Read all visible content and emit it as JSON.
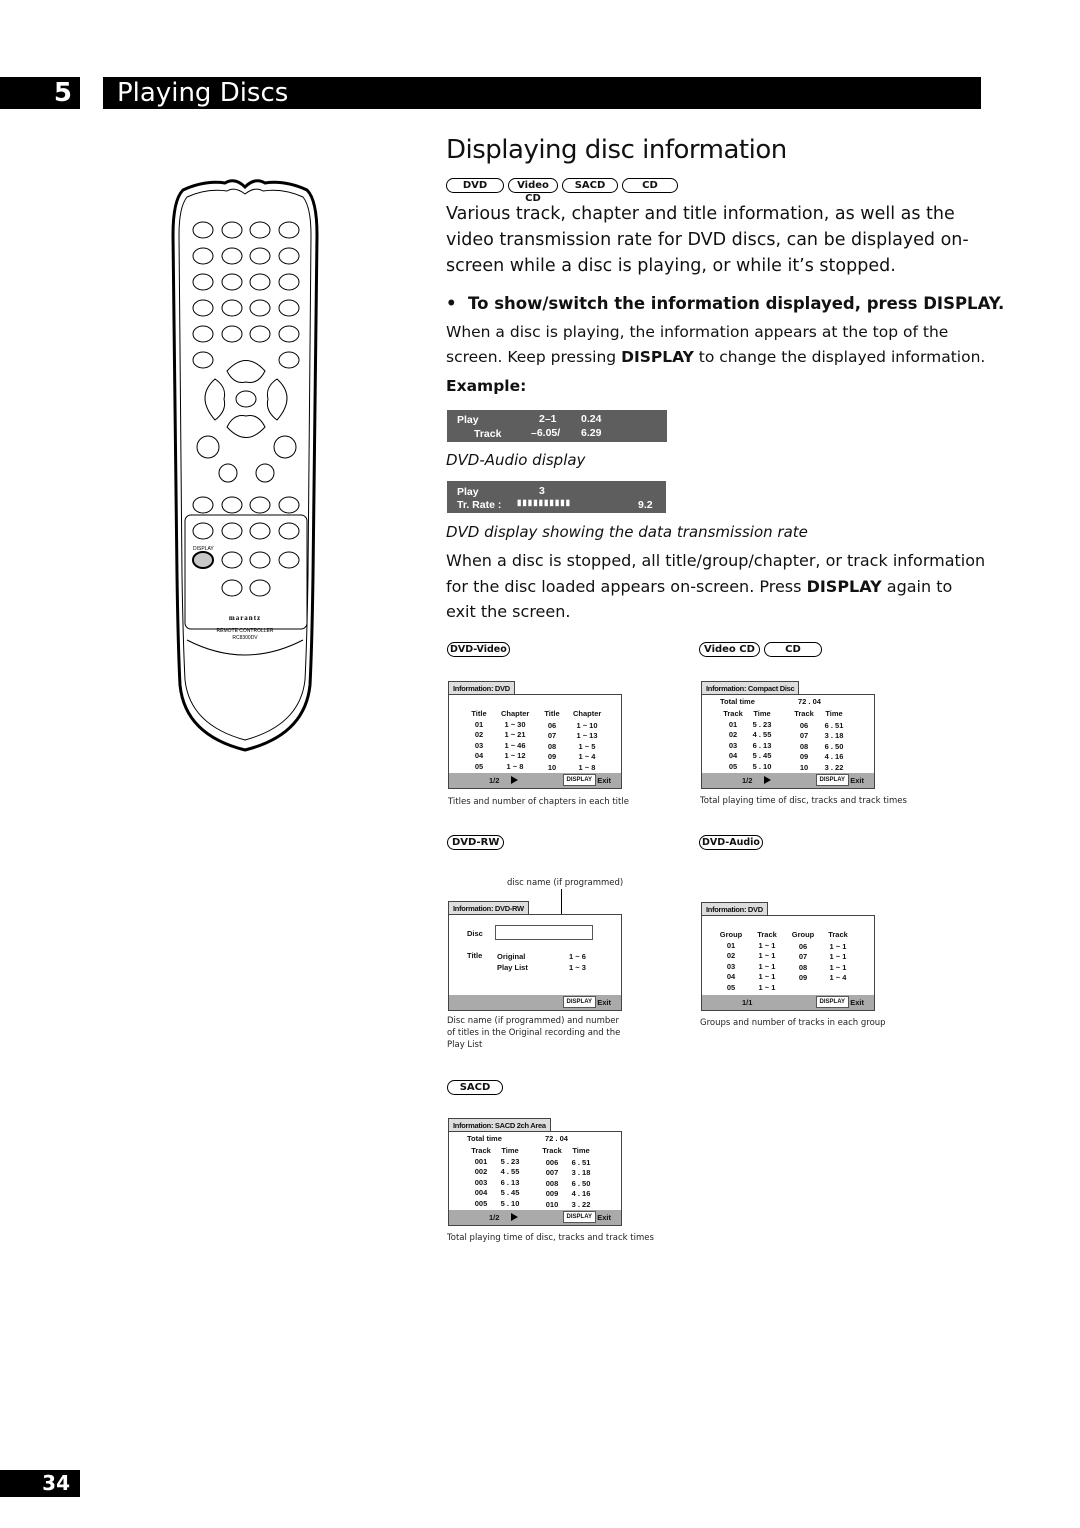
{
  "header": {
    "chapter_number": "5",
    "chapter_title": "Playing Discs"
  },
  "page_title": "Displaying disc information",
  "disc_types": [
    "DVD",
    "Video CD",
    "SACD",
    "CD"
  ],
  "intro": "Various track, chapter and title information, as well as the video transmission rate for DVD discs, can be displayed on-screen while a disc is playing, or while it’s stopped.",
  "instruction": {
    "bullet": "•",
    "heading": "To show/switch the information displayed, press DISPLAY.",
    "text_before": "When a disc is playing, the information appears at the top of the screen. Keep pressing ",
    "text_bold": "DISPLAY",
    "text_after": " to change the displayed information.",
    "example_label": "Example:"
  },
  "osd_audio": {
    "row1_label": "Play",
    "row1_value": "2–1",
    "row1_time": "0.24",
    "row2_label": "Track",
    "row2_value": "–6.05/",
    "row2_time": "6.29",
    "caption": "DVD-Audio display"
  },
  "osd_rate": {
    "row1_label": "Play",
    "row1_value": "3",
    "row2_label": "Tr. Rate :",
    "row2_bars": "▮▮▮▮▮▮▮▮▮▮",
    "row2_value": "9.2",
    "rate_level": 9.2,
    "caption": "DVD display showing the data transmission rate"
  },
  "stopped": {
    "text_before": "When a disc is stopped, all title/group/chapter, or track information for the disc loaded appears on-screen. Press ",
    "text_bold": "DISPLAY",
    "text_after": " again to exit the screen."
  },
  "screens": {
    "dvd_video": {
      "badge": "DVD-Video",
      "tab": "Information: DVD",
      "headers": [
        "Title",
        "Chapter",
        "Title",
        "Chapter"
      ],
      "rows": [
        [
          "01",
          "1 ~ 30",
          "06",
          "1 ~ 10"
        ],
        [
          "02",
          "1 ~ 21",
          "07",
          "1 ~ 13"
        ],
        [
          "03",
          "1 ~ 46",
          "08",
          "1 ~ 5"
        ],
        [
          "04",
          "1 ~ 12",
          "09",
          "1 ~ 4"
        ],
        [
          "05",
          "1 ~ 8",
          "10",
          "1 ~ 8"
        ]
      ],
      "page": "1/2",
      "display_btn": "DISPLAY",
      "exit": "Exit",
      "caption": "Titles and number of chapters in each title"
    },
    "cd": {
      "badges": [
        "Video CD",
        "CD"
      ],
      "tab": "Information: Compact Disc",
      "total_label": "Total time",
      "total_value": "72 . 04",
      "headers": [
        "Track",
        "Time",
        "Track",
        "Time"
      ],
      "rows": [
        [
          "01",
          "5 . 23",
          "06",
          "6 . 51"
        ],
        [
          "02",
          "4 . 55",
          "07",
          "3 . 18"
        ],
        [
          "03",
          "6 . 13",
          "08",
          "6 . 50"
        ],
        [
          "04",
          "5 . 45",
          "09",
          "4 . 16"
        ],
        [
          "05",
          "5 . 10",
          "10",
          "3 . 22"
        ]
      ],
      "page": "1/2",
      "display_btn": "DISPLAY",
      "exit": "Exit",
      "caption": "Total playing time of disc, tracks and track times"
    },
    "dvd_rw": {
      "badge": "DVD-RW",
      "callout": "disc name (if programmed)",
      "tab": "Information: DVD-RW",
      "disc_label": "Disc",
      "title_label": "Title",
      "rows": [
        [
          "Original",
          "1 ~ 6"
        ],
        [
          "Play List",
          "1 ~ 3"
        ]
      ],
      "display_btn": "DISPLAY",
      "exit": "Exit",
      "caption": "Disc name (if programmed) and number of titles in the Original recording and the Play List"
    },
    "dvd_audio": {
      "badge": "DVD-Audio",
      "tab": "Information: DVD",
      "headers": [
        "Group",
        "Track",
        "Group",
        "Track"
      ],
      "rows": [
        [
          "01",
          "1 ~ 1",
          "06",
          "1 ~ 1"
        ],
        [
          "02",
          "1 ~ 1",
          "07",
          "1 ~ 1"
        ],
        [
          "03",
          "1 ~ 1",
          "08",
          "1 ~ 1"
        ],
        [
          "04",
          "1 ~ 1",
          "09",
          "1 ~ 4"
        ],
        [
          "05",
          "1 ~ 1",
          "",
          ""
        ]
      ],
      "page": "1/1",
      "display_btn": "DISPLAY",
      "exit": "Exit",
      "caption": "Groups and number of tracks in each group"
    },
    "sacd": {
      "badge": "SACD",
      "tab": "Information: SACD 2ch Area",
      "total_label": "Total time",
      "total_value": "72 . 04",
      "headers": [
        "Track",
        "Time",
        "Track",
        "Time"
      ],
      "rows": [
        [
          "001",
          "5 . 23",
          "006",
          "6 . 51"
        ],
        [
          "002",
          "4 . 55",
          "007",
          "3 . 18"
        ],
        [
          "003",
          "6 . 13",
          "008",
          "6 . 50"
        ],
        [
          "004",
          "5 . 45",
          "009",
          "4 . 16"
        ],
        [
          "005",
          "5 . 10",
          "010",
          "3 . 22"
        ]
      ],
      "page": "1/2",
      "display_btn": "DISPLAY",
      "exit": "Exit",
      "caption": "Total playing time of disc, tracks and track times"
    }
  },
  "remote": {
    "display_label": "DISPLAY",
    "brand": "marantz",
    "model_line1": "REMOTE CONTROLLER",
    "model_line2": "RC8300DV",
    "highlight_color": "#c8c8c8"
  },
  "page_number": "34"
}
